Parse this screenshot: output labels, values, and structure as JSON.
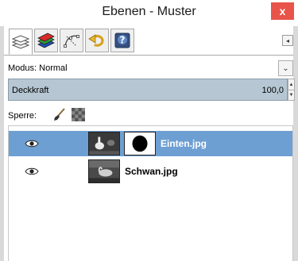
{
  "window": {
    "title": "Ebenen - Muster",
    "close_symbol": "x"
  },
  "tabs": [
    {
      "name": "layers-tab",
      "icon": "layers-icon",
      "active": true
    },
    {
      "name": "channels-tab",
      "icon": "channels-icon",
      "active": false
    },
    {
      "name": "paths-tab",
      "icon": "paths-icon",
      "active": false
    },
    {
      "name": "undo-history-tab",
      "icon": "undo-history-icon",
      "active": false
    },
    {
      "name": "help-tab",
      "icon": "help-icon",
      "active": false
    }
  ],
  "mode": {
    "label": "Modus: Normal"
  },
  "opacity": {
    "label": "Deckkraft",
    "value": "100,0"
  },
  "lock": {
    "label": "Sperre:"
  },
  "layers": [
    {
      "name": "Einten.jpg",
      "selected": true,
      "visible": true,
      "has_mask": true
    },
    {
      "name": "Schwan.jpg",
      "selected": false,
      "visible": true,
      "has_mask": false
    }
  ],
  "colors": {
    "selection": "#6e9fd3",
    "opacity_field": "#b6c7d3",
    "close_button": "#e8534a"
  }
}
